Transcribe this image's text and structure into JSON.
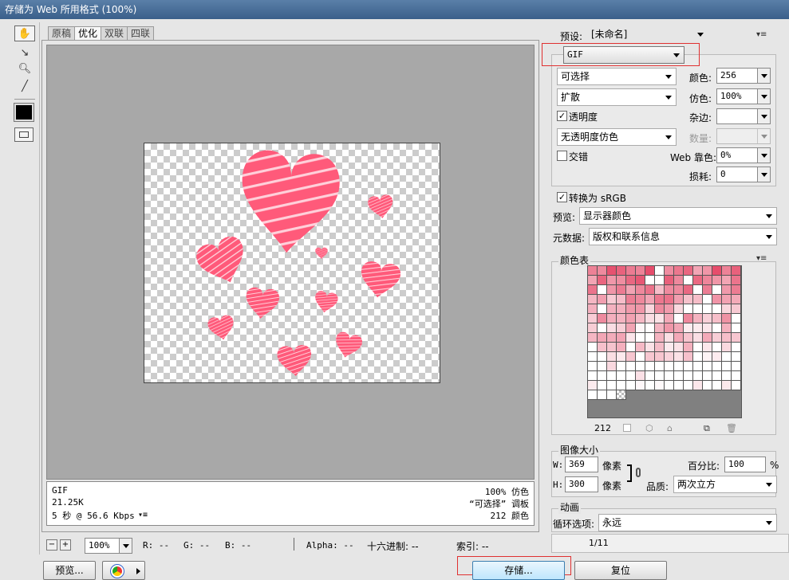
{
  "window": {
    "title": "存储为 Web 所用格式 (100%)"
  },
  "tabs": [
    {
      "label": "原稿"
    },
    {
      "label": "优化"
    },
    {
      "label": "双联"
    },
    {
      "label": "四联"
    }
  ],
  "info": {
    "format": "GIF",
    "size": "21.25K",
    "time": "5 秒 @ 56.6 Kbps",
    "dither": "100% 仿色",
    "palette": "“可选择” 调板",
    "colors": "212 颜色"
  },
  "status": {
    "zoom": "100%",
    "r": "R: --",
    "g": "G: --",
    "b": "B: --",
    "alpha": "Alpha: --",
    "hex": "十六进制: --",
    "index": "索引: --"
  },
  "bottom": {
    "preview": "预览...",
    "save": "存储...",
    "reset": "复位"
  },
  "right": {
    "preset_label": "预设:",
    "preset_value": "[未命名]",
    "format": "GIF",
    "reduction": "可选择",
    "colors_label": "颜色:",
    "colors_value": "256",
    "dither_algo": "扩散",
    "dither_label": "仿色:",
    "dither_value": "100%",
    "transparency_label": "透明度",
    "matte_label": "杂边:",
    "trans_dither": "无透明度仿色",
    "amount_label": "数量:",
    "interlaced_label": "交错",
    "web_snap_label": "Web 靠色:",
    "web_snap_value": "0%",
    "lossy_label": "损耗:",
    "lossy_value": "0",
    "srgb_label": "转换为 sRGB",
    "preview_label": "预览:",
    "preview_value": "显示器颜色",
    "metadata_label": "元数据:",
    "metadata_value": "版权和联系信息",
    "colortable_label": "颜色表",
    "colortable_count": "212",
    "imagesize_label": "图像大小",
    "w_label": "W:",
    "w_value": "369",
    "h_label": "H:",
    "h_value": "300",
    "px": "像素",
    "percent_label": "百分比:",
    "percent_value": "100",
    "percent_unit": "%",
    "quality_label": "品质:",
    "quality_value": "两次立方",
    "anim_label": "动画",
    "loop_label": "循环选项:",
    "loop_value": "永远",
    "frame": "1/11"
  },
  "colors": {
    "heart": "#ff5a7a",
    "accent_red": "#e03030"
  }
}
